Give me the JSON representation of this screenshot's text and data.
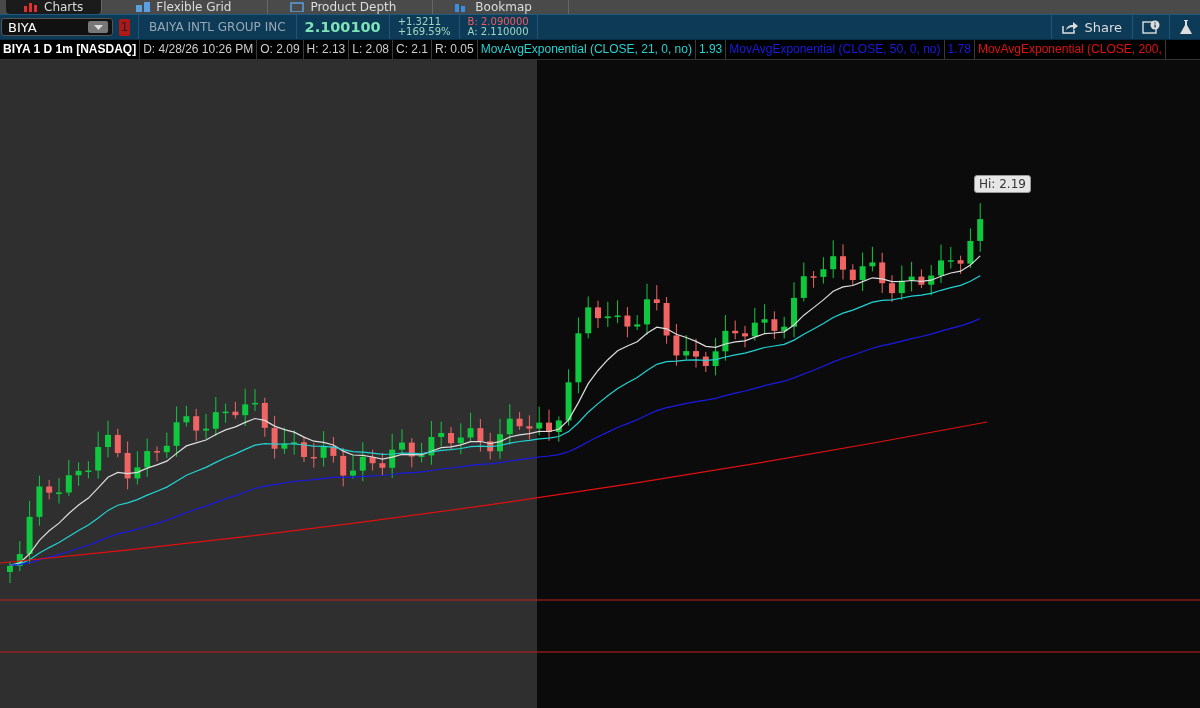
{
  "tabs": [
    {
      "label": "Charts",
      "selected": true
    },
    {
      "label": "Flexible Grid",
      "selected": false
    },
    {
      "label": "Product Depth",
      "selected": false
    },
    {
      "label": "Bookmap",
      "selected": false
    }
  ],
  "toolbar": {
    "symbol": "BIYA",
    "link_group": "1",
    "company": "BAIYA INTL GROUP INC",
    "last": "2.100100",
    "change": "+1.3211",
    "change_percent": "+169.59%",
    "bid": "B: 2.090000",
    "ask": "A: 2.110000",
    "share": "Share"
  },
  "study_bar": {
    "title": "BIYA 1 D 1m [NASDAQ]",
    "fields": [
      "D: 4/28/26 10:26 PM",
      "O: 2.09",
      "H: 2.13",
      "L: 2.08",
      "C: 2.1",
      "R: 0.05"
    ],
    "studies": [
      {
        "name": "MovAvgExponential (CLOSE, 21, 0, no)",
        "value": "1.93",
        "color": "#22d3d3"
      },
      {
        "name": "MovAvgExponential (CLOSE, 50, 0, no)",
        "value": "1.78",
        "color": "#1a1ae6"
      },
      {
        "name": "MovAvgExponential (CLOSE, 200,",
        "color": "#e01010"
      }
    ]
  },
  "chart": {
    "high_label": "Hi: 2.19"
  }
}
